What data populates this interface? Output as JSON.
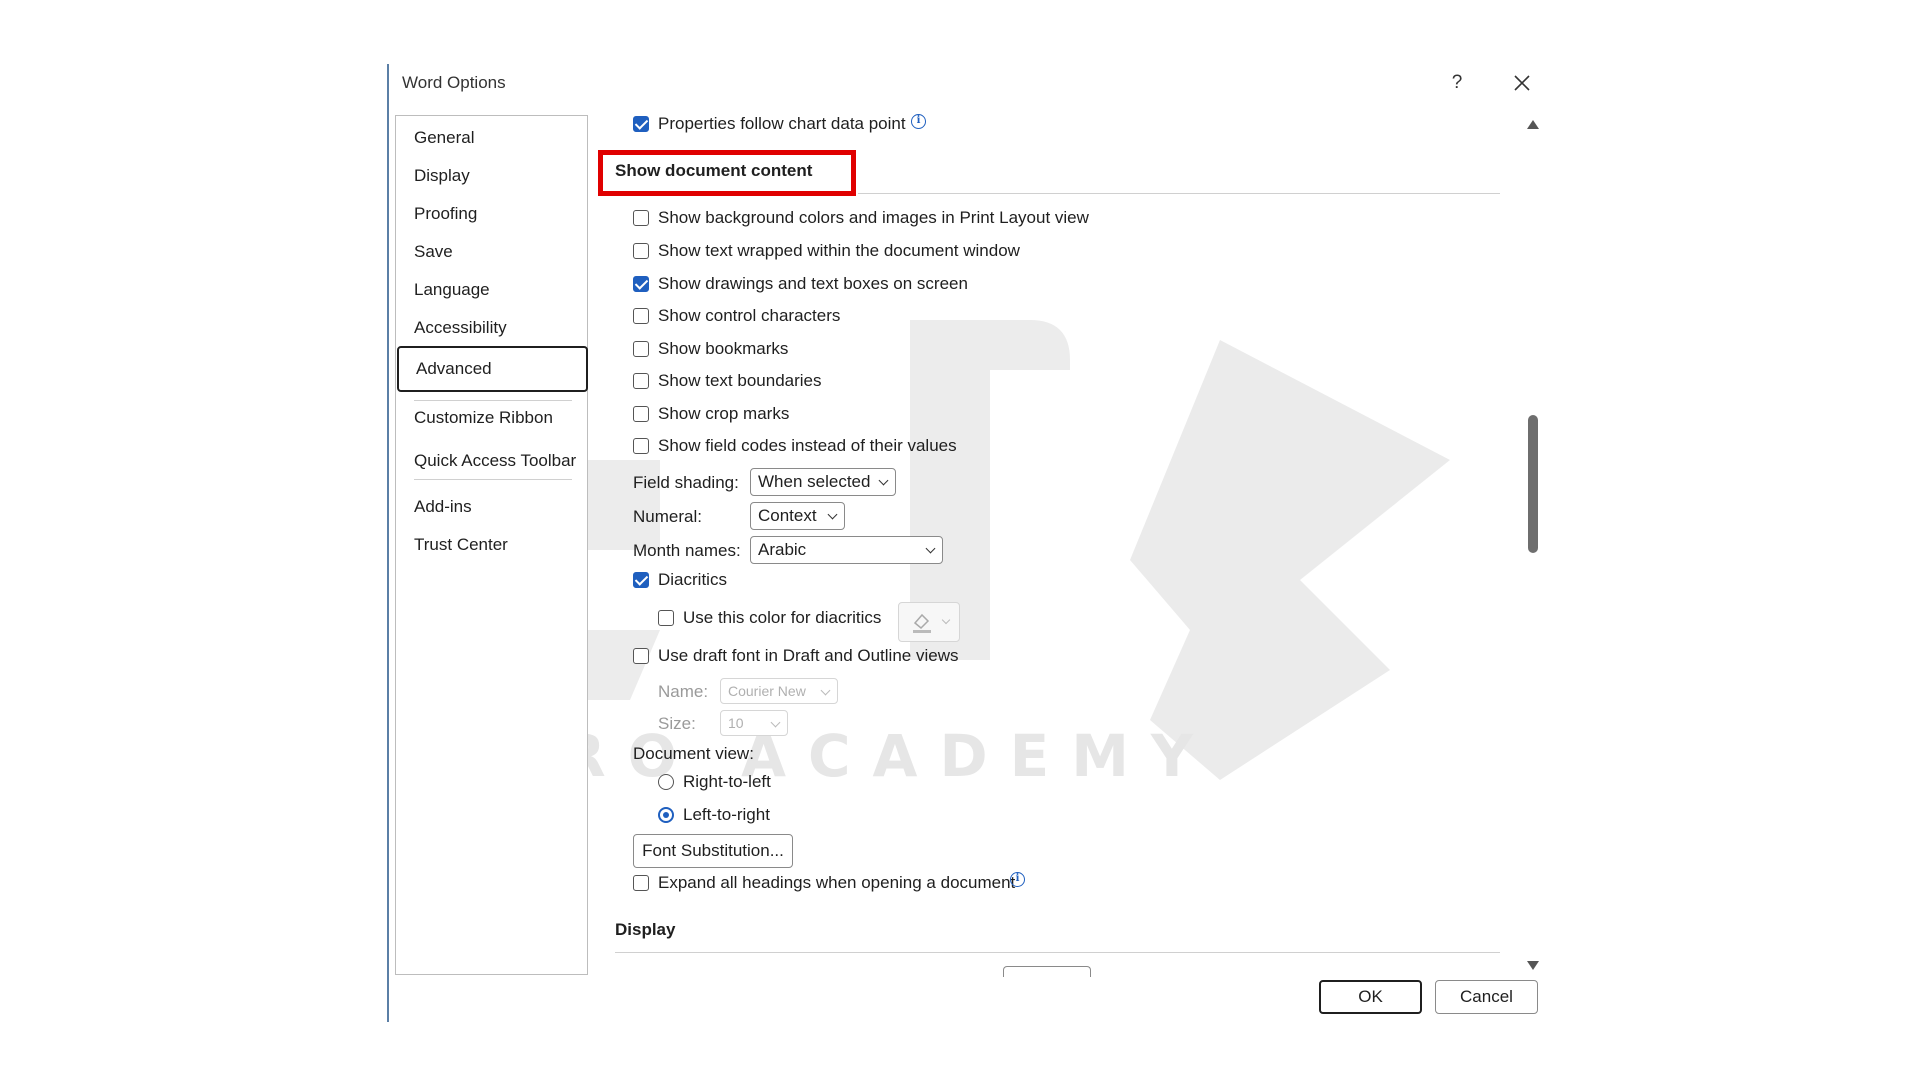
{
  "dialog": {
    "title": "Word Options",
    "help_label": "?"
  },
  "sidebar": {
    "items": [
      {
        "label": "General"
      },
      {
        "label": "Display"
      },
      {
        "label": "Proofing"
      },
      {
        "label": "Save"
      },
      {
        "label": "Language"
      },
      {
        "label": "Accessibility"
      },
      {
        "label": "Advanced",
        "selected": true
      },
      {
        "label": "Customize Ribbon"
      },
      {
        "label": "Quick Access Toolbar"
      },
      {
        "label": "Add-ins"
      },
      {
        "label": "Trust Center"
      }
    ]
  },
  "content": {
    "top_option": {
      "label": "Properties follow chart data point",
      "checked": true
    },
    "section_title": "Show document content",
    "options": [
      {
        "label": "Show background colors and images in Print Layout view",
        "checked": false
      },
      {
        "label": "Show text wrapped within the document window",
        "checked": false
      },
      {
        "label": "Show drawings and text boxes on screen",
        "checked": true
      },
      {
        "label": "Show control characters",
        "checked": false
      },
      {
        "label": "Show bookmarks",
        "checked": false
      },
      {
        "label": "Show text boundaries",
        "checked": false
      },
      {
        "label": "Show crop marks",
        "checked": false
      },
      {
        "label": "Show field codes instead of their values",
        "checked": false
      }
    ],
    "field_shading": {
      "label": "Field shading:",
      "value": "When selected"
    },
    "numeral": {
      "label": "Numeral:",
      "value": "Context"
    },
    "month_names": {
      "label": "Month names:",
      "value": "Arabic"
    },
    "diacritics": {
      "label": "Diacritics",
      "checked": true
    },
    "diacritics_color": {
      "label": "Use this color for diacritics",
      "checked": false
    },
    "draft_font": {
      "label": "Use draft font in Draft and Outline views",
      "checked": false
    },
    "draft_name": {
      "label": "Name:",
      "value": "Courier New"
    },
    "draft_size": {
      "label": "Size:",
      "value": "10"
    },
    "document_view": {
      "label": "Document view:",
      "options": [
        {
          "label": "Right-to-left",
          "selected": false
        },
        {
          "label": "Left-to-right",
          "selected": true
        }
      ]
    },
    "font_substitution_label": "Font Substitution...",
    "expand_headings": {
      "label": "Expand all headings when opening a document",
      "checked": false
    },
    "next_section_title": "Display"
  },
  "footer": {
    "ok_label": "OK",
    "cancel_label": "Cancel"
  },
  "watermark": {
    "text": "ATRO ACADEMY"
  },
  "colors": {
    "accent": "#1f5fbf",
    "highlight": "#e00000"
  }
}
